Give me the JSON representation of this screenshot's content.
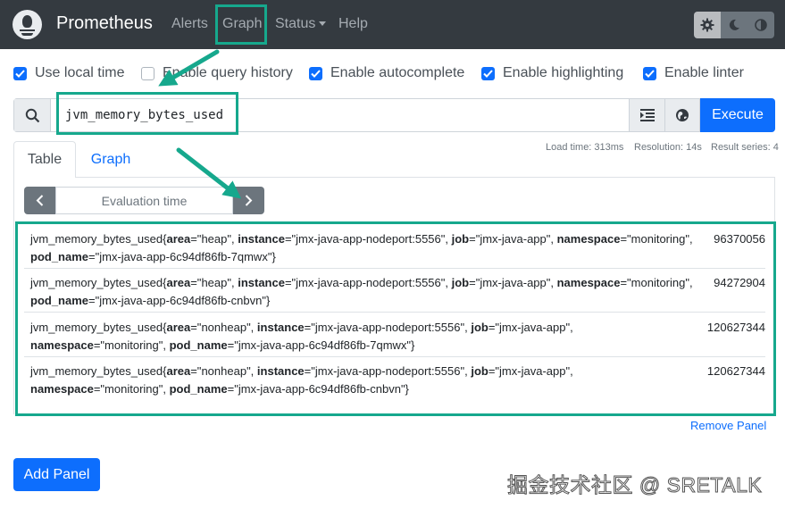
{
  "navbar": {
    "brand": "Prometheus",
    "links": {
      "alerts": "Alerts",
      "graph": "Graph",
      "status": "Status",
      "help": "Help"
    }
  },
  "options": {
    "use_local_time": {
      "label": "Use local time",
      "checked": true
    },
    "query_history": {
      "label": "Enable query history",
      "checked": false
    },
    "autocomplete": {
      "label": "Enable autocomplete",
      "checked": true
    },
    "highlighting": {
      "label": "Enable highlighting",
      "checked": true
    },
    "linter": {
      "label": "Enable linter",
      "checked": true
    }
  },
  "query": {
    "expression": "jvm_memory_bytes_used",
    "execute_label": "Execute"
  },
  "stats": {
    "load_time": "Load time: 313ms",
    "resolution": "Resolution: 14s",
    "result_series": "Result series: 4"
  },
  "tabs": {
    "table": "Table",
    "graph": "Graph"
  },
  "eval": {
    "placeholder": "Evaluation time"
  },
  "results": [
    {
      "metric": "jvm_memory_bytes_used",
      "labels": [
        {
          "k": "area",
          "v": "heap"
        },
        {
          "k": "instance",
          "v": "jmx-java-app-nodeport:5556"
        },
        {
          "k": "job",
          "v": "jmx-java-app"
        },
        {
          "k": "namespace",
          "v": "monitoring"
        },
        {
          "k": "pod_name",
          "v": "jmx-java-app-6c94df86fb-7qmwx"
        }
      ],
      "value": "96370056"
    },
    {
      "metric": "jvm_memory_bytes_used",
      "labels": [
        {
          "k": "area",
          "v": "heap"
        },
        {
          "k": "instance",
          "v": "jmx-java-app-nodeport:5556"
        },
        {
          "k": "job",
          "v": "jmx-java-app"
        },
        {
          "k": "namespace",
          "v": "monitoring"
        },
        {
          "k": "pod_name",
          "v": "jmx-java-app-6c94df86fb-cnbvn"
        }
      ],
      "value": "94272904"
    },
    {
      "metric": "jvm_memory_bytes_used",
      "labels": [
        {
          "k": "area",
          "v": "nonheap"
        },
        {
          "k": "instance",
          "v": "jmx-java-app-nodeport:5556"
        },
        {
          "k": "job",
          "v": "jmx-java-app"
        },
        {
          "k": "namespace",
          "v": "monitoring"
        },
        {
          "k": "pod_name",
          "v": "jmx-java-app-6c94df86fb-7qmwx"
        }
      ],
      "value": "120627344"
    },
    {
      "metric": "jvm_memory_bytes_used",
      "labels": [
        {
          "k": "area",
          "v": "nonheap"
        },
        {
          "k": "instance",
          "v": "jmx-java-app-nodeport:5556"
        },
        {
          "k": "job",
          "v": "jmx-java-app"
        },
        {
          "k": "namespace",
          "v": "monitoring"
        },
        {
          "k": "pod_name",
          "v": "jmx-java-app-6c94df86fb-cnbvn"
        }
      ],
      "value": "120627344"
    }
  ],
  "remove_panel": "Remove Panel",
  "add_panel": "Add Panel",
  "watermark": "掘金技术社区 @ SRETALK",
  "colors": {
    "navbar": "#343a40",
    "primary": "#0d6efd",
    "highlight": "#16a88d",
    "secondary": "#6c757d"
  }
}
